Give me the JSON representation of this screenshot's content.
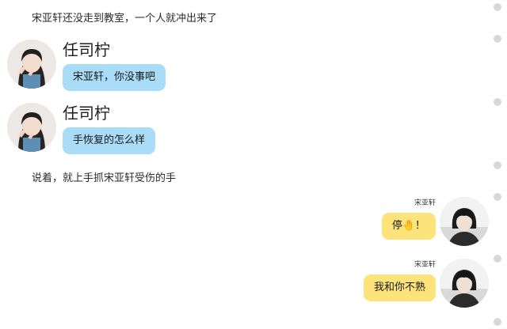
{
  "narration": {
    "line1": "宋亚轩还没走到教室，一个人就冲出来了",
    "line2": "说着，就上手抓宋亚轩受伤的手"
  },
  "messages": [
    {
      "side": "left",
      "name": "任司柠",
      "text": "宋亚轩，你没事吧"
    },
    {
      "side": "left",
      "name": "任司柠",
      "text": "手恢复的怎么样"
    },
    {
      "side": "right",
      "name": "宋亚轩",
      "text": "停🤚！"
    },
    {
      "side": "right",
      "name": "宋亚轩",
      "text": "我和你不熟"
    }
  ],
  "colors": {
    "left_bubble": "#a9dcf7",
    "right_bubble": "#fce37a",
    "background": "#ffffff"
  },
  "icons": {
    "left_avatar": "girl-selfie-avatar",
    "right_avatar": "boy-portrait-avatar"
  }
}
